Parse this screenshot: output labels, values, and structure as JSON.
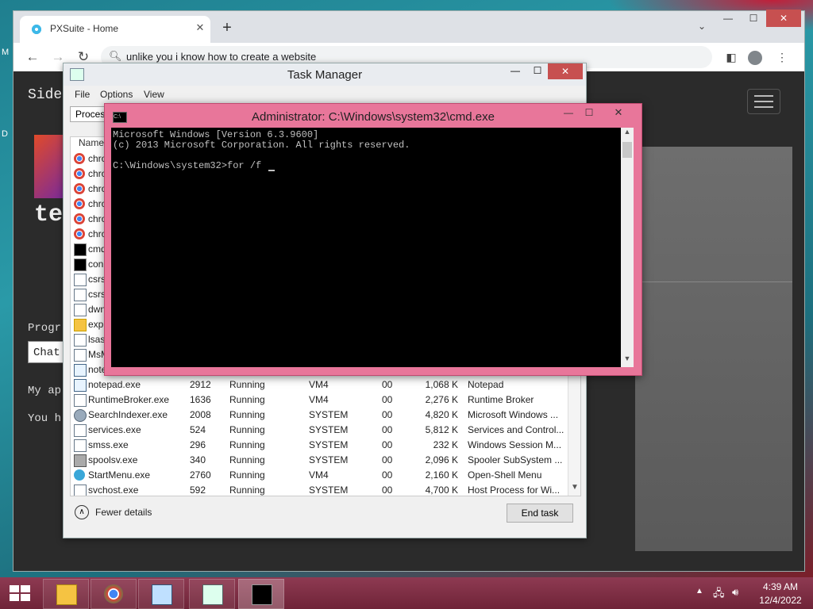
{
  "desktop": {
    "icon_m": "M",
    "icon_d": "D"
  },
  "browser": {
    "tab_title": "PXSuite - Home",
    "address": "unlike you i know how to create a website",
    "icons": {
      "back": "back-arrow-icon",
      "forward": "forward-arrow-icon",
      "reload": "reload-icon",
      "search": "search-icon"
    }
  },
  "webpage": {
    "sidebar_title": "Side",
    "big_text": "te",
    "prog_text": "Progr",
    "chat_button": "Chat",
    "my_text": "My ap",
    "you_text": "You h"
  },
  "task_manager": {
    "title": "Task Manager",
    "menu": [
      "File",
      "Options",
      "View"
    ],
    "tab": "Proces",
    "column_name": "Name",
    "rows": [
      {
        "icon": "chrome",
        "name": "chro",
        "pid": "",
        "status": "",
        "user": "",
        "cpu": "",
        "mem": "",
        "desc": ""
      },
      {
        "icon": "chrome",
        "name": "chro",
        "pid": "",
        "status": "",
        "user": "",
        "cpu": "",
        "mem": "",
        "desc": ""
      },
      {
        "icon": "chrome",
        "name": "chro",
        "pid": "",
        "status": "",
        "user": "",
        "cpu": "",
        "mem": "",
        "desc": ""
      },
      {
        "icon": "chrome",
        "name": "chro",
        "pid": "",
        "status": "",
        "user": "",
        "cpu": "",
        "mem": "",
        "desc": ""
      },
      {
        "icon": "chrome",
        "name": "chro",
        "pid": "",
        "status": "",
        "user": "",
        "cpu": "",
        "mem": "",
        "desc": ""
      },
      {
        "icon": "chrome",
        "name": "chro",
        "pid": "",
        "status": "",
        "user": "",
        "cpu": "",
        "mem": "",
        "desc": ""
      },
      {
        "icon": "cmd",
        "name": "cmd",
        "pid": "",
        "status": "",
        "user": "",
        "cpu": "",
        "mem": "",
        "desc": ""
      },
      {
        "icon": "cmd",
        "name": "con",
        "pid": "",
        "status": "",
        "user": "",
        "cpu": "",
        "mem": "",
        "desc": ""
      },
      {
        "icon": "exe",
        "name": "csrs",
        "pid": "",
        "status": "",
        "user": "",
        "cpu": "",
        "mem": "",
        "desc": ""
      },
      {
        "icon": "exe",
        "name": "csrs",
        "pid": "",
        "status": "",
        "user": "",
        "cpu": "",
        "mem": "",
        "desc": ""
      },
      {
        "icon": "exe",
        "name": "dwn",
        "pid": "",
        "status": "",
        "user": "",
        "cpu": "",
        "mem": "",
        "desc": ""
      },
      {
        "icon": "folder",
        "name": "expl",
        "pid": "",
        "status": "",
        "user": "",
        "cpu": "",
        "mem": "",
        "desc": ""
      },
      {
        "icon": "exe",
        "name": "lsass",
        "pid": "",
        "status": "",
        "user": "",
        "cpu": "",
        "mem": "",
        "desc": ""
      },
      {
        "icon": "exe",
        "name": "MsM",
        "pid": "",
        "status": "",
        "user": "",
        "cpu": "",
        "mem": "",
        "desc": ""
      },
      {
        "icon": "notepad",
        "name": "note",
        "pid": "",
        "status": "",
        "user": "",
        "cpu": "",
        "mem": "",
        "desc": ""
      },
      {
        "icon": "notepad",
        "name": "notepad.exe",
        "pid": "2912",
        "status": "Running",
        "user": "VM4",
        "cpu": "00",
        "mem": "1,068 K",
        "desc": "Notepad"
      },
      {
        "icon": "exe",
        "name": "RuntimeBroker.exe",
        "pid": "1636",
        "status": "Running",
        "user": "VM4",
        "cpu": "00",
        "mem": "2,276 K",
        "desc": "Runtime Broker"
      },
      {
        "icon": "search",
        "name": "SearchIndexer.exe",
        "pid": "2008",
        "status": "Running",
        "user": "SYSTEM",
        "cpu": "00",
        "mem": "4,820 K",
        "desc": "Microsoft Windows ..."
      },
      {
        "icon": "exe",
        "name": "services.exe",
        "pid": "524",
        "status": "Running",
        "user": "SYSTEM",
        "cpu": "00",
        "mem": "5,812 K",
        "desc": "Services and Control..."
      },
      {
        "icon": "exe",
        "name": "smss.exe",
        "pid": "296",
        "status": "Running",
        "user": "SYSTEM",
        "cpu": "00",
        "mem": "232 K",
        "desc": "Windows Session M..."
      },
      {
        "icon": "printer",
        "name": "spoolsv.exe",
        "pid": "340",
        "status": "Running",
        "user": "SYSTEM",
        "cpu": "00",
        "mem": "2,096 K",
        "desc": "Spooler SubSystem ..."
      },
      {
        "icon": "start",
        "name": "StartMenu.exe",
        "pid": "2760",
        "status": "Running",
        "user": "VM4",
        "cpu": "00",
        "mem": "2,160 K",
        "desc": "Open-Shell Menu"
      },
      {
        "icon": "exe",
        "name": "svchost.exe",
        "pid": "592",
        "status": "Running",
        "user": "SYSTEM",
        "cpu": "00",
        "mem": "4,700 K",
        "desc": "Host Process for Wi..."
      }
    ],
    "fewer_details": "Fewer details",
    "end_task": "End task"
  },
  "cmd": {
    "title": "Administrator: C:\\Windows\\system32\\cmd.exe",
    "icon_text": "C:\\",
    "lines": [
      "Microsoft Windows [Version 6.3.9600]",
      "(c) 2013 Microsoft Corporation. All rights reserved.",
      "",
      "C:\\Windows\\system32>for /f "
    ]
  },
  "taskbar": {
    "apps": [
      "file-explorer",
      "chrome",
      "notepad",
      "task-manager",
      "command-prompt"
    ],
    "time": "4:39 AM",
    "date": "12/4/2022"
  },
  "colors": {
    "cmd_frame": "#e8769a",
    "taskbar": "#7a2a42",
    "close_red": "#c75050"
  }
}
